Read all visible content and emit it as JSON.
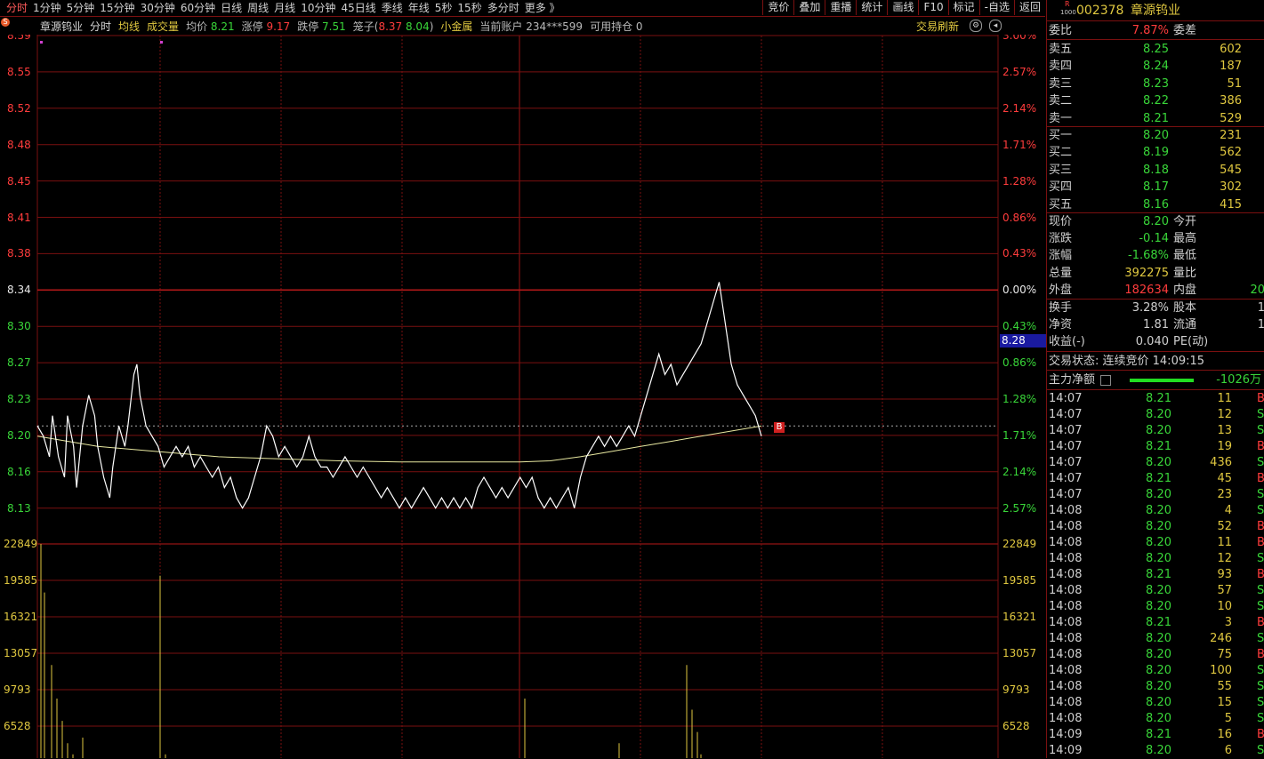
{
  "periods": [
    "分时",
    "1分钟",
    "5分钟",
    "15分钟",
    "30分钟",
    "60分钟",
    "日线",
    "周线",
    "月线",
    "10分钟",
    "45日线",
    "季线",
    "年线",
    "5秒",
    "15秒",
    "多分时",
    "更多 》"
  ],
  "active_period": "分时",
  "tools": [
    "竞价",
    "叠加",
    "重播",
    "统计",
    "画线",
    "F10",
    "标记",
    "-自选",
    "返回"
  ],
  "info": {
    "badge": "S",
    "name": "章源钨业",
    "mode": "分时",
    "avg_line": "均线",
    "volume": "成交量",
    "avg_label": "均价",
    "avg_value": "8.21",
    "limit_up_label": "涨停",
    "limit_up_value": "9.17",
    "limit_down_label": "跌停",
    "limit_down_value": "7.51",
    "basket_label": "笼子(",
    "basket_hi": "8.37",
    "basket_lo": "8.04",
    "basket_close": ")",
    "gold": "小金属",
    "account_label": "当前账户",
    "account_value": "234***599",
    "holding_label": "可用持仓",
    "holding_value": "0",
    "refresh": "交易刷新"
  },
  "price_axis": {
    "left": [
      "8.59",
      "8.55",
      "8.52",
      "8.48",
      "8.45",
      "8.41",
      "8.38",
      "8.34",
      "8.30",
      "8.27",
      "8.23",
      "8.20",
      "8.16",
      "8.13"
    ],
    "right": [
      "3.00%",
      "2.57%",
      "2.14%",
      "1.71%",
      "1.28%",
      "0.86%",
      "0.43%",
      "0.00%",
      "0.43%",
      "0.86%",
      "1.28%",
      "1.71%",
      "2.14%",
      "2.57%"
    ],
    "current_tag": "8.28",
    "pre_close": "8.34"
  },
  "volume_axis": [
    "22849",
    "19585",
    "16321",
    "13057",
    "9793",
    "6528"
  ],
  "trade_marker": "B",
  "chart_data": {
    "type": "line",
    "title": "",
    "ylim": [
      8.09,
      8.59
    ],
    "xlim": [
      0,
      240
    ],
    "series": [
      {
        "values": [
          [
            0,
            8.21
          ],
          [
            2,
            8.2
          ],
          [
            4,
            8.18
          ],
          [
            5,
            8.22
          ],
          [
            7,
            8.18
          ],
          [
            9,
            8.16
          ],
          [
            10,
            8.22
          ],
          [
            12,
            8.19
          ],
          [
            13,
            8.15
          ],
          [
            14,
            8.18
          ],
          [
            15,
            8.21
          ],
          [
            17,
            8.24
          ],
          [
            19,
            8.22
          ],
          [
            20,
            8.19
          ],
          [
            22,
            8.16
          ],
          [
            24,
            8.14
          ],
          [
            25,
            8.17
          ],
          [
            27,
            8.21
          ],
          [
            29,
            8.19
          ],
          [
            30,
            8.21
          ],
          [
            32,
            8.26
          ],
          [
            33,
            8.27
          ],
          [
            34,
            8.24
          ],
          [
            36,
            8.21
          ],
          [
            38,
            8.2
          ],
          [
            40,
            8.19
          ],
          [
            42,
            8.17
          ],
          [
            44,
            8.18
          ],
          [
            46,
            8.19
          ],
          [
            48,
            8.18
          ],
          [
            50,
            8.19
          ],
          [
            52,
            8.17
          ],
          [
            54,
            8.18
          ],
          [
            56,
            8.17
          ],
          [
            58,
            8.16
          ],
          [
            60,
            8.17
          ],
          [
            62,
            8.15
          ],
          [
            64,
            8.16
          ],
          [
            66,
            8.14
          ],
          [
            68,
            8.13
          ],
          [
            70,
            8.14
          ],
          [
            72,
            8.16
          ],
          [
            74,
            8.18
          ],
          [
            76,
            8.21
          ],
          [
            78,
            8.2
          ],
          [
            80,
            8.18
          ],
          [
            82,
            8.19
          ],
          [
            84,
            8.18
          ],
          [
            86,
            8.17
          ],
          [
            88,
            8.18
          ],
          [
            90,
            8.2
          ],
          [
            92,
            8.18
          ],
          [
            94,
            8.17
          ],
          [
            96,
            8.17
          ],
          [
            98,
            8.16
          ],
          [
            100,
            8.17
          ],
          [
            102,
            8.18
          ],
          [
            104,
            8.17
          ],
          [
            106,
            8.16
          ],
          [
            108,
            8.17
          ],
          [
            110,
            8.16
          ],
          [
            112,
            8.15
          ],
          [
            114,
            8.14
          ],
          [
            116,
            8.15
          ],
          [
            118,
            8.14
          ],
          [
            120,
            8.13
          ],
          [
            122,
            8.14
          ],
          [
            124,
            8.13
          ],
          [
            126,
            8.14
          ],
          [
            128,
            8.15
          ],
          [
            130,
            8.14
          ],
          [
            132,
            8.13
          ],
          [
            134,
            8.14
          ],
          [
            136,
            8.13
          ],
          [
            138,
            8.14
          ],
          [
            140,
            8.13
          ],
          [
            142,
            8.14
          ],
          [
            144,
            8.13
          ],
          [
            146,
            8.15
          ],
          [
            148,
            8.16
          ],
          [
            150,
            8.15
          ],
          [
            152,
            8.14
          ],
          [
            154,
            8.15
          ],
          [
            156,
            8.14
          ],
          [
            158,
            8.15
          ],
          [
            160,
            8.16
          ],
          [
            162,
            8.15
          ],
          [
            164,
            8.16
          ],
          [
            166,
            8.14
          ],
          [
            168,
            8.13
          ],
          [
            170,
            8.14
          ],
          [
            172,
            8.13
          ],
          [
            174,
            8.14
          ],
          [
            176,
            8.15
          ],
          [
            178,
            8.13
          ],
          [
            180,
            8.16
          ],
          [
            182,
            8.18
          ],
          [
            184,
            8.19
          ],
          [
            186,
            8.2
          ],
          [
            188,
            8.19
          ],
          [
            190,
            8.2
          ],
          [
            192,
            8.19
          ],
          [
            194,
            8.2
          ],
          [
            196,
            8.21
          ],
          [
            198,
            8.2
          ],
          [
            200,
            8.22
          ],
          [
            202,
            8.24
          ],
          [
            204,
            8.26
          ],
          [
            206,
            8.28
          ],
          [
            208,
            8.26
          ],
          [
            210,
            8.27
          ],
          [
            212,
            8.25
          ],
          [
            214,
            8.26
          ],
          [
            216,
            8.27
          ],
          [
            218,
            8.28
          ],
          [
            220,
            8.29
          ],
          [
            222,
            8.31
          ],
          [
            224,
            8.33
          ],
          [
            226,
            8.35
          ],
          [
            228,
            8.31
          ],
          [
            230,
            8.27
          ],
          [
            232,
            8.25
          ],
          [
            234,
            8.24
          ],
          [
            236,
            8.23
          ],
          [
            238,
            8.22
          ],
          [
            240,
            8.2
          ]
        ]
      },
      {
        "values": [
          [
            0,
            8.2
          ],
          [
            20,
            8.19
          ],
          [
            40,
            8.185
          ],
          [
            60,
            8.18
          ],
          [
            80,
            8.178
          ],
          [
            100,
            8.176
          ],
          [
            120,
            8.175
          ],
          [
            140,
            8.175
          ],
          [
            160,
            8.175
          ],
          [
            170,
            8.176
          ],
          [
            180,
            8.18
          ],
          [
            190,
            8.185
          ],
          [
            200,
            8.19
          ],
          [
            210,
            8.195
          ],
          [
            220,
            8.2
          ],
          [
            230,
            8.205
          ],
          [
            240,
            8.21
          ]
        ]
      }
    ],
    "volume": [
      22849,
      18500,
      12000,
      9000,
      7000,
      5000,
      4000,
      3500,
      5500,
      3000,
      2500,
      20000,
      4000,
      3000,
      9000,
      5000,
      12000,
      8000,
      6000,
      4000,
      3000,
      3500
    ]
  },
  "panel": {
    "code": "002378",
    "code_badge": "R",
    "code_sub": "1000",
    "name": "章源钨业",
    "webi_label": "委比",
    "webi_value": "7.87%",
    "weicha_label": "委差",
    "asks": [
      {
        "label": "卖五",
        "price": "8.25",
        "vol": "602"
      },
      {
        "label": "卖四",
        "price": "8.24",
        "vol": "187"
      },
      {
        "label": "卖三",
        "price": "8.23",
        "vol": "51"
      },
      {
        "label": "卖二",
        "price": "8.22",
        "vol": "386"
      },
      {
        "label": "卖一",
        "price": "8.21",
        "vol": "529"
      }
    ],
    "bids": [
      {
        "label": "买一",
        "price": "8.20",
        "vol": "231"
      },
      {
        "label": "买二",
        "price": "8.19",
        "vol": "562"
      },
      {
        "label": "买三",
        "price": "8.18",
        "vol": "545"
      },
      {
        "label": "买四",
        "price": "8.17",
        "vol": "302"
      },
      {
        "label": "买五",
        "price": "8.16",
        "vol": "415"
      }
    ],
    "stats": [
      {
        "l1": "现价",
        "v1": "8.20",
        "l2": "今开",
        "v2": "",
        "c1": "#39d639"
      },
      {
        "l1": "涨跌",
        "v1": "-0.14",
        "l2": "最高",
        "v2": "",
        "c1": "#39d639"
      },
      {
        "l1": "涨幅",
        "v1": "-1.68%",
        "l2": "最低",
        "v2": "",
        "c1": "#39d639"
      },
      {
        "l1": "总量",
        "v1": "392275",
        "l2": "量比",
        "v2": "",
        "c1": "#e0c840"
      },
      {
        "l1": "外盘",
        "v1": "182634",
        "l2": "内盘",
        "v2": "20",
        "c1": "#ff3c3c"
      }
    ],
    "stats2": [
      {
        "l1": "换手",
        "v1": "3.28%",
        "l2": "股本",
        "v2": "1"
      },
      {
        "l1": "净资",
        "v1": "1.81",
        "l2": "流通",
        "v2": "1"
      },
      {
        "l1": "收益(-)",
        "v1": "0.040",
        "l2": "PE(动)",
        "v2": ""
      }
    ],
    "trade_status": "交易状态: 连续竞价 14:09:15",
    "main_flow_label": "主力净额",
    "main_flow_value": "-1026万",
    "ticks": [
      {
        "t": "14:07",
        "p": "8.21",
        "v": "11",
        "d": "B"
      },
      {
        "t": "14:07",
        "p": "8.20",
        "v": "12",
        "d": "S"
      },
      {
        "t": "14:07",
        "p": "8.20",
        "v": "13",
        "d": "S"
      },
      {
        "t": "14:07",
        "p": "8.21",
        "v": "19",
        "d": "B"
      },
      {
        "t": "14:07",
        "p": "8.20",
        "v": "436",
        "d": "S"
      },
      {
        "t": "14:07",
        "p": "8.21",
        "v": "45",
        "d": "B"
      },
      {
        "t": "14:07",
        "p": "8.20",
        "v": "23",
        "d": "S"
      },
      {
        "t": "14:08",
        "p": "8.20",
        "v": "4",
        "d": "S"
      },
      {
        "t": "14:08",
        "p": "8.20",
        "v": "52",
        "d": "B"
      },
      {
        "t": "14:08",
        "p": "8.20",
        "v": "11",
        "d": "B"
      },
      {
        "t": "14:08",
        "p": "8.20",
        "v": "12",
        "d": "S"
      },
      {
        "t": "14:08",
        "p": "8.21",
        "v": "93",
        "d": "B"
      },
      {
        "t": "14:08",
        "p": "8.20",
        "v": "57",
        "d": "S"
      },
      {
        "t": "14:08",
        "p": "8.20",
        "v": "10",
        "d": "S"
      },
      {
        "t": "14:08",
        "p": "8.21",
        "v": "3",
        "d": "B"
      },
      {
        "t": "14:08",
        "p": "8.20",
        "v": "246",
        "d": "S"
      },
      {
        "t": "14:08",
        "p": "8.20",
        "v": "75",
        "d": "B"
      },
      {
        "t": "14:08",
        "p": "8.20",
        "v": "100",
        "d": "S"
      },
      {
        "t": "14:08",
        "p": "8.20",
        "v": "55",
        "d": "S"
      },
      {
        "t": "14:08",
        "p": "8.20",
        "v": "15",
        "d": "S"
      },
      {
        "t": "14:08",
        "p": "8.20",
        "v": "5",
        "d": "S"
      },
      {
        "t": "14:09",
        "p": "8.21",
        "v": "16",
        "d": "B"
      },
      {
        "t": "14:09",
        "p": "8.20",
        "v": "6",
        "d": "S"
      }
    ]
  },
  "colors": {
    "grid": "#7a1010",
    "price": "#ffffff",
    "avg": "#e8e8a0",
    "volume": "#e0c840",
    "up": "#ff3c3c",
    "down": "#39d639"
  }
}
